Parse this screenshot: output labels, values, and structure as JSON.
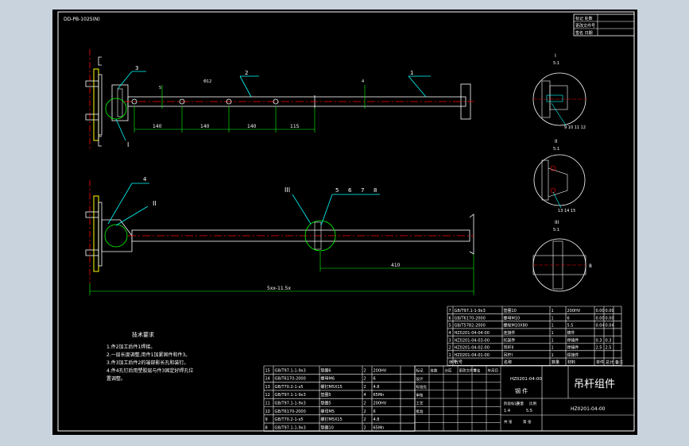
{
  "drawing": {
    "header_code": "DD-PB-1025(N)",
    "top_revision_labels": [
      "标记 处数",
      "更改文件号",
      "签名 日期"
    ],
    "main_view": {
      "part_balloons": [
        "3",
        "2",
        "1"
      ],
      "dimension_labels": [
        "140",
        "140",
        "140",
        "115"
      ],
      "small_dims": [
        "Φ12",
        "5",
        "4"
      ],
      "section_marker": "I"
    },
    "lower_view": {
      "part_balloons": [
        "4",
        "5",
        "6",
        "7",
        "8"
      ],
      "section_markers": [
        "II",
        "III"
      ],
      "dimension_labels": [
        "410",
        "5xx-11.5x"
      ]
    },
    "detail_views": {
      "view_i": {
        "label": "I",
        "scale": "5:1",
        "callout": "9 10 11 12"
      },
      "view_ii": {
        "label": "II",
        "scale": "5:1",
        "callout": "13 14 15"
      },
      "view_iii": {
        "label": "III",
        "scale": "5:1",
        "dim": "8"
      }
    },
    "notes": {
      "title": "技术要求",
      "lines": [
        "1.件2加工后件1焊接。",
        "2.一层长度调整,用件1加紧固件和件3。",
        "3.件3加工后件2的端部影长孔和装钉。",
        "4.件4孔钉后用塑胶层与件3固定好焊孔位",
        "   置调整。"
      ]
    },
    "bom_upper": {
      "rows": [
        [
          "7",
          "GB/T97.1-1-9x3",
          "垫圈10",
          "1",
          "200HV",
          "0.00",
          "0.00"
        ],
        [
          "6",
          "GB/T6170-2000",
          "螺母M10",
          "1",
          "6",
          "0.00",
          "0.00"
        ],
        [
          "5",
          "GB/T5782-2000",
          "螺栓M10X80",
          "1",
          "5.5",
          "0.04",
          "0.04"
        ],
        [
          "4",
          "HZ0201-04-04-00",
          "连接件",
          "1",
          "铸件",
          "",
          ""
        ],
        [
          "3",
          "HZ0201-04-03-00",
          "托架件",
          "1",
          "焊接件",
          "0.3",
          "0.3"
        ],
        [
          "2",
          "HZ0201-04-02-00",
          "吊杆II",
          "1",
          "焊接件",
          "2.5",
          "2.5"
        ],
        [
          "1",
          "HZ0201-04-01-00",
          "吊杆I",
          "1",
          "焊接件",
          "",
          ""
        ]
      ],
      "header": [
        "序号",
        "代号",
        "名称",
        "数量",
        "材料",
        "单件",
        "总计",
        "备注"
      ]
    },
    "bom_lower": {
      "rows": [
        [
          "15",
          "GB/T97.1-1-9x3",
          "垫圈6",
          "2",
          "200HV"
        ],
        [
          "14",
          "GB/T6170-2000",
          "螺母M6",
          "2",
          "6"
        ],
        [
          "13",
          "GB/T70.2-1-x5",
          "螺钉M5X15",
          "2",
          "4.8"
        ],
        [
          "12",
          "GB/T97.1-1-9x3",
          "垫圈5",
          "4",
          "65Mn"
        ],
        [
          "11",
          "GB/T97.1-1-9x3",
          "垫圈5",
          "2",
          "200HV"
        ],
        [
          "10",
          "GB/T6170-2000",
          "螺母M5",
          "2",
          "6"
        ],
        [
          "9",
          "GB/T70.2-1-x5",
          "螺钉M5X15",
          "2",
          "4.8"
        ],
        [
          "8",
          "GB/T97.1-1-9x3",
          "垫圈10",
          "2",
          "65Mn"
        ]
      ]
    },
    "title_block": {
      "title": "吊杆组件",
      "code_main": "HZ0201-04-00",
      "code_repeat": "HZ0201-04-00",
      "material_label": "钢 件",
      "scale": "1:4",
      "weight": "5.5",
      "sheet_labels": [
        "共 张",
        "第 张"
      ],
      "role_labels": [
        "标记",
        "处数",
        "分区",
        "更改文件号",
        "签名",
        "年月日",
        "设计",
        "标准化",
        "审核",
        "工艺",
        "批准"
      ],
      "stage_labels": [
        "阶段标记",
        "重量",
        "比例"
      ]
    }
  }
}
